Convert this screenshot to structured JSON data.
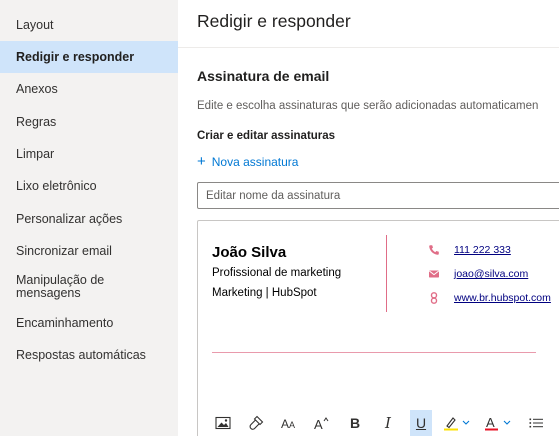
{
  "sidebar": {
    "items": [
      {
        "label": "Layout",
        "selected": false
      },
      {
        "label": "Redigir e responder",
        "selected": true
      },
      {
        "label": "Anexos",
        "selected": false
      },
      {
        "label": "Regras",
        "selected": false
      },
      {
        "label": "Limpar",
        "selected": false
      },
      {
        "label": "Lixo eletrônico",
        "selected": false
      },
      {
        "label": "Personalizar ações",
        "selected": false
      },
      {
        "label": "Sincronizar email",
        "selected": false
      },
      {
        "label": "Manipulação de mensagens",
        "selected": false
      },
      {
        "label": "Encaminhamento",
        "selected": false
      },
      {
        "label": "Respostas automáticas",
        "selected": false
      }
    ]
  },
  "main": {
    "title": "Redigir e responder",
    "section_title": "Assinatura de email",
    "section_desc": "Edite e escolha assinaturas que serão adicionadas automaticamen",
    "subsection_title": "Criar e editar assinaturas",
    "new_signature_label": "Nova assinatura",
    "name_input": {
      "value": "",
      "placeholder": "Editar nome da assinatura"
    }
  },
  "signature": {
    "name": "João Silva",
    "role": "Profissional de marketing",
    "company": "Marketing | HubSpot",
    "phone": "111 222 333",
    "email": "joao@silva.com",
    "website": "www.br.hubspot.com",
    "accent_color": "#e06d87"
  },
  "toolbar": {
    "buttons": [
      "image-icon",
      "format-painter-icon",
      "font-size-decrease-icon",
      "font-size-increase-icon",
      "bold-icon",
      "italic-icon",
      "underline-icon",
      "highlight-icon",
      "font-color-icon",
      "bullets-icon"
    ],
    "bold": "B",
    "italic": "I",
    "underline": "U",
    "font_color": "A",
    "underline_active": true
  },
  "colors": {
    "sidebar_bg": "#f3f2f1",
    "selected_bg": "#cfe4fa",
    "accent": "#0078d4",
    "highlight_yellow": "#fce100",
    "font_color_red": "#e81123"
  }
}
